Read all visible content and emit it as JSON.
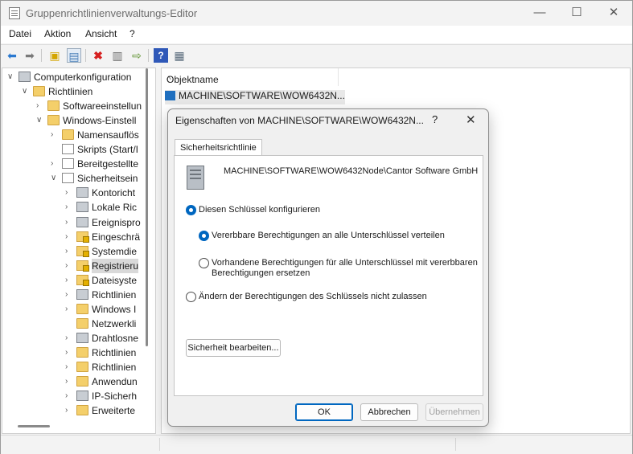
{
  "window": {
    "title": "Gruppenrichtlinienverwaltungs-Editor",
    "minimize": "—",
    "maximize": "☐",
    "close": "✕"
  },
  "menu": [
    "Datei",
    "Aktion",
    "Ansicht",
    "?"
  ],
  "tree": [
    {
      "label": "Computerkonfiguration",
      "exp": "∨",
      "icon": "computer",
      "depth": 0
    },
    {
      "label": "Richtlinien",
      "exp": "∨",
      "icon": "folder",
      "depth": 1
    },
    {
      "label": "Softwareeinstellun",
      "exp": "›",
      "icon": "folder",
      "depth": 2
    },
    {
      "label": "Windows-Einstell",
      "exp": "∨",
      "icon": "folder",
      "depth": 2
    },
    {
      "label": "Namensauflös",
      "exp": "›",
      "icon": "folder",
      "depth": 3
    },
    {
      "label": "Skripts (Start/I",
      "exp": "",
      "icon": "doc",
      "depth": 3
    },
    {
      "label": "Bereitgestellte",
      "exp": "›",
      "icon": "doc",
      "depth": 3
    },
    {
      "label": "Sicherheitsein",
      "exp": "∨",
      "icon": "doc",
      "depth": 3
    },
    {
      "label": "Kontoricht",
      "exp": "›",
      "icon": "server",
      "depth": 4
    },
    {
      "label": "Lokale Ric",
      "exp": "›",
      "icon": "server",
      "depth": 4
    },
    {
      "label": "Ereignispro",
      "exp": "›",
      "icon": "server",
      "depth": 4
    },
    {
      "label": "Eingeschrä",
      "exp": "›",
      "icon": "folder-lock",
      "depth": 4
    },
    {
      "label": "Systemdie",
      "exp": "›",
      "icon": "folder-lock",
      "depth": 4
    },
    {
      "label": "Registrieru",
      "exp": "›",
      "icon": "folder-lock",
      "depth": 4,
      "selected": true
    },
    {
      "label": "Dateisyste",
      "exp": "›",
      "icon": "folder-lock",
      "depth": 4
    },
    {
      "label": "Richtlinien",
      "exp": "›",
      "icon": "server",
      "depth": 4
    },
    {
      "label": "Windows I",
      "exp": "›",
      "icon": "folder",
      "depth": 4
    },
    {
      "label": "Netzwerkli",
      "exp": "",
      "icon": "folder",
      "depth": 4
    },
    {
      "label": "Drahtlosne",
      "exp": "›",
      "icon": "server",
      "depth": 4
    },
    {
      "label": "Richtlinien",
      "exp": "›",
      "icon": "folder",
      "depth": 4
    },
    {
      "label": "Richtlinien",
      "exp": "›",
      "icon": "folder",
      "depth": 4
    },
    {
      "label": "Anwendun",
      "exp": "›",
      "icon": "folder",
      "depth": 4
    },
    {
      "label": "IP-Sicherh",
      "exp": "›",
      "icon": "server",
      "depth": 4
    },
    {
      "label": "Erweiterte",
      "exp": "›",
      "icon": "folder",
      "depth": 4
    }
  ],
  "list": {
    "column_header": "Objektname",
    "sort_caret": "^",
    "rows": [
      "MACHINE\\SOFTWARE\\WOW6432N..."
    ]
  },
  "dialog": {
    "title": "Eigenschaften von MACHINE\\SOFTWARE\\WOW6432N...",
    "help": "?",
    "close": "✕",
    "tab": "Sicherheitsrichtlinie",
    "key_path": "MACHINE\\SOFTWARE\\WOW6432Node\\Cantor Software GmbH",
    "radio_configure": "Diesen Schlüssel konfigurieren",
    "radio_propagate": "Vererbbare Berechtigungen an alle Unterschlüssel verteilen",
    "radio_replace_line1": "Vorhandene Berechtigungen für alle Unterschlüssel mit vererbbaren",
    "radio_replace_line2": "Berechtigungen ersetzen",
    "radio_deny": "Ändern der Berechtigungen des Schlüssels nicht zulassen",
    "edit_security": "Sicherheit bearbeiten...",
    "ok": "OK",
    "cancel": "Abbrechen",
    "apply": "Übernehmen"
  }
}
